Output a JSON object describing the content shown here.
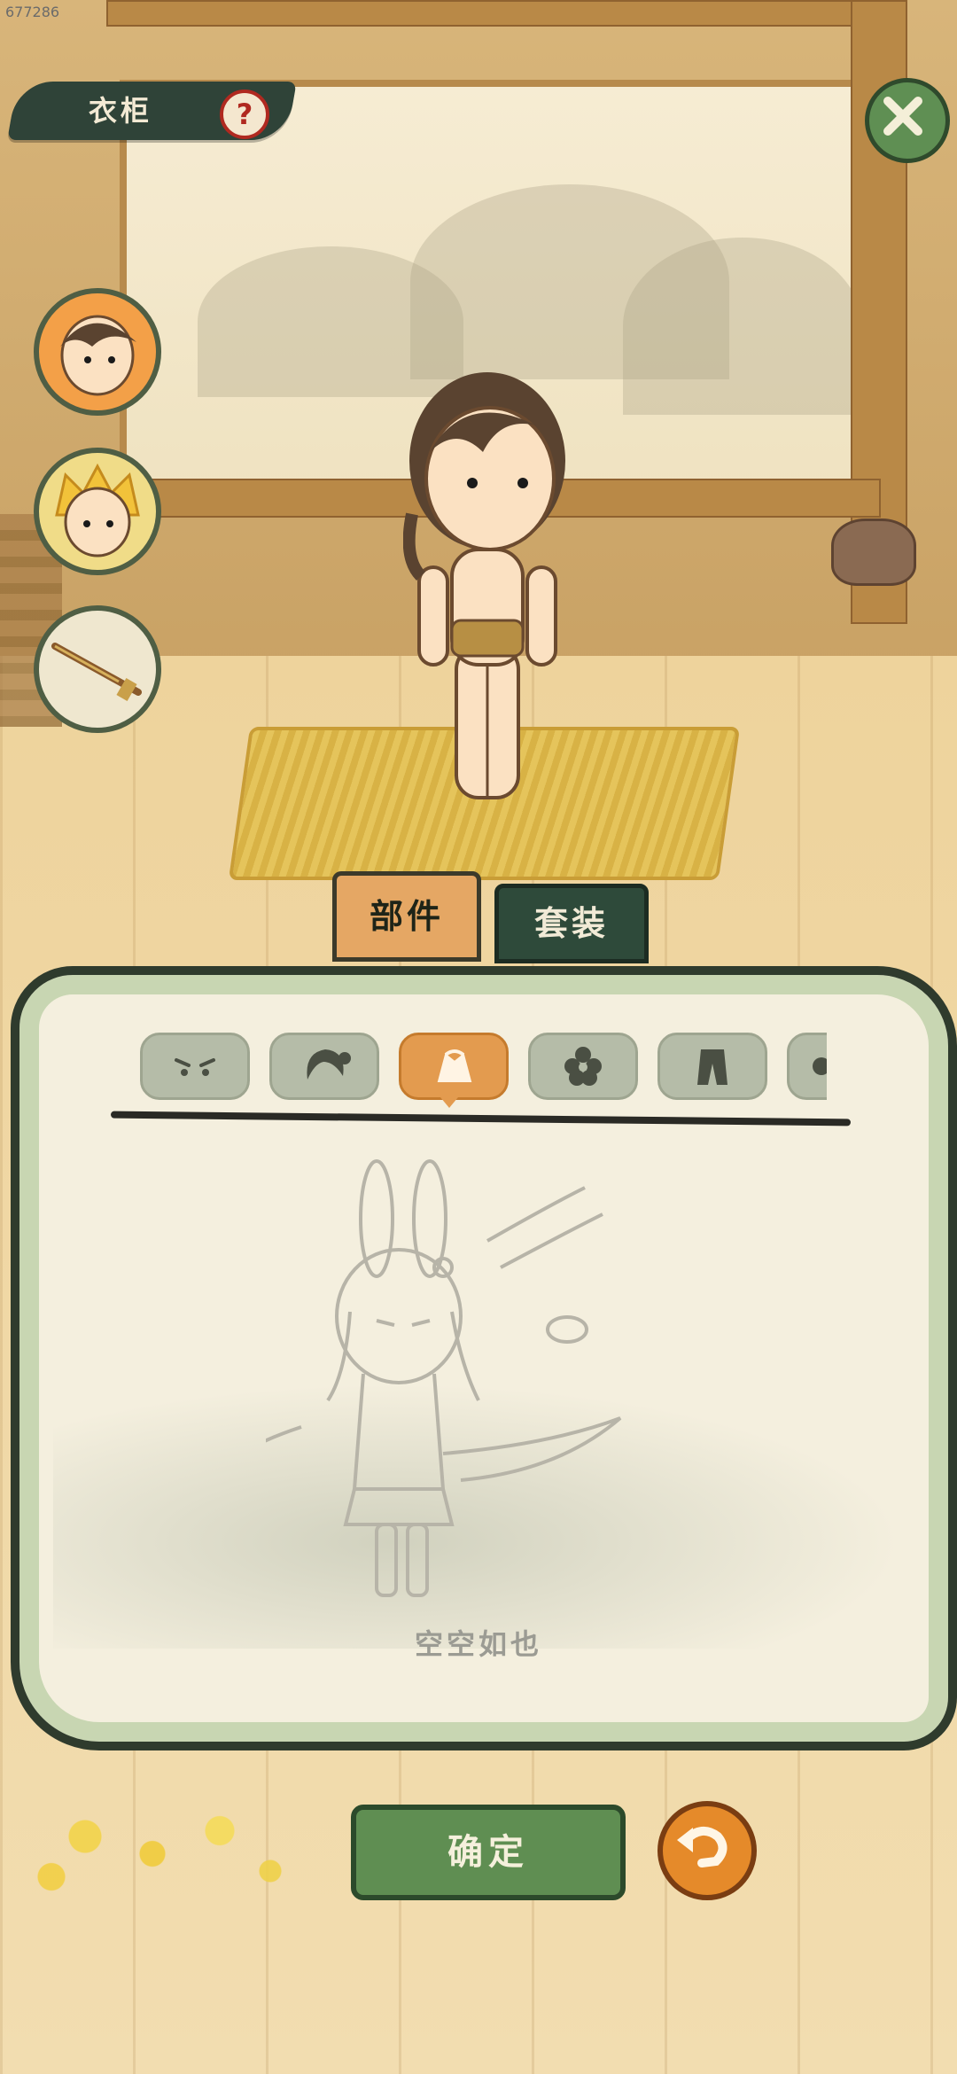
{
  "corner_id": "677286",
  "header": {
    "title": "衣柜",
    "help_symbol": "?"
  },
  "tabs": [
    {
      "label": "部件",
      "active": true
    },
    {
      "label": "套装",
      "active": false
    }
  ],
  "categories": [
    "eyes-icon",
    "hair-icon",
    "clothing-icon",
    "flower-icon",
    "pants-icon",
    "more-icon"
  ],
  "selected_category": "clothing-icon",
  "empty_state": {
    "text": "空空如也"
  },
  "footer": {
    "confirm_label": "确定"
  },
  "colors": {
    "accent_orange": "#e39b4f",
    "dark_green": "#2f4338",
    "button_green": "#5f8e52",
    "help_red": "#b02920"
  }
}
